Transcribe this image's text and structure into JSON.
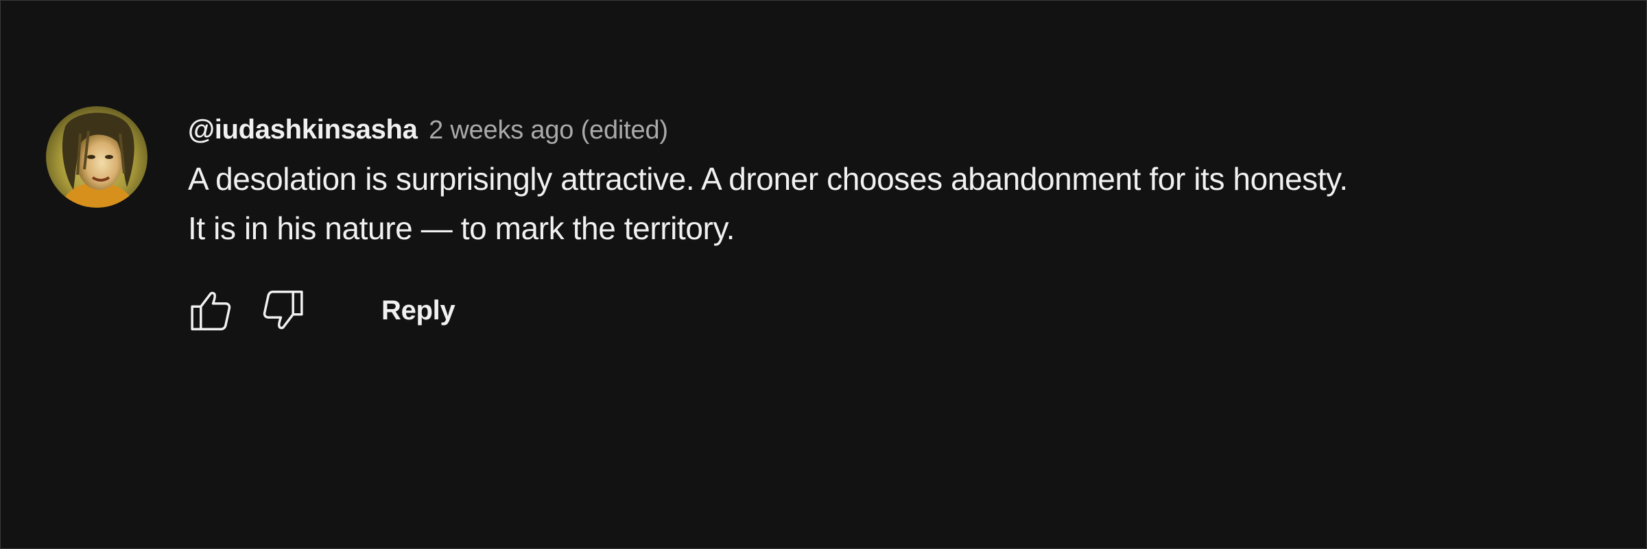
{
  "comment": {
    "author": "@iudashkinsasha",
    "timestamp": "2 weeks ago (edited)",
    "text_lines": [
      "A desolation is surprisingly attractive. A droner chooses abandonment for its honesty.",
      "It is in his nature — to mark the territory."
    ],
    "avatar_icon": "user-avatar-photo",
    "actions": {
      "like_icon": "thumb-up-icon",
      "dislike_icon": "thumb-down-icon",
      "reply_label": "Reply"
    }
  },
  "colors": {
    "background": "#121212",
    "primary_text": "#f1f1f1",
    "secondary_text": "#aaaaaa"
  }
}
